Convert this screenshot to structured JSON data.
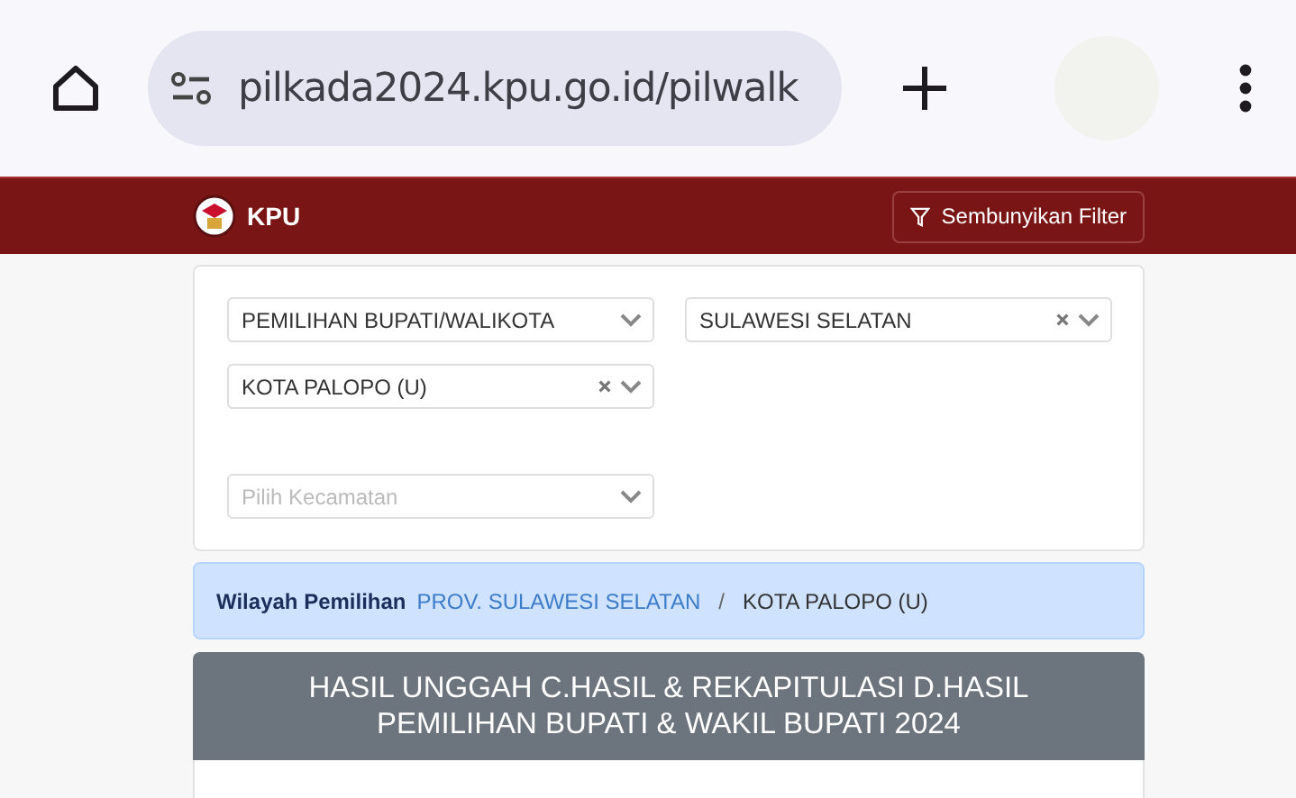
{
  "browser": {
    "url": "pilkada2024.kpu.go.id/pilwalk"
  },
  "header": {
    "logo_text": "KPU",
    "filter_button": "Sembunyikan Filter"
  },
  "filters": [
    {
      "value": "PEMILIHAN BUPATI/WALIKOTA",
      "clearable": false
    },
    {
      "value": "SULAWESI SELATAN",
      "clearable": true
    },
    {
      "value": "KOTA PALOPO (U)",
      "clearable": true
    },
    {
      "placeholder": "Pilih Kecamatan",
      "clearable": false
    }
  ],
  "breadcrumb": {
    "label": "Wilayah Pemilihan",
    "items": [
      {
        "text": "PROV. SULAWESI SELATAN",
        "kind": "link"
      },
      {
        "text": "/",
        "kind": "separator"
      },
      {
        "text": "KOTA PALOPO (U)",
        "kind": "current"
      }
    ]
  },
  "title": [
    "HASIL UNGGAH C.HASIL & REKAPITULASI D.HASIL",
    "PEMILIHAN BUPATI & WAKIL BUPATI 2024"
  ]
}
